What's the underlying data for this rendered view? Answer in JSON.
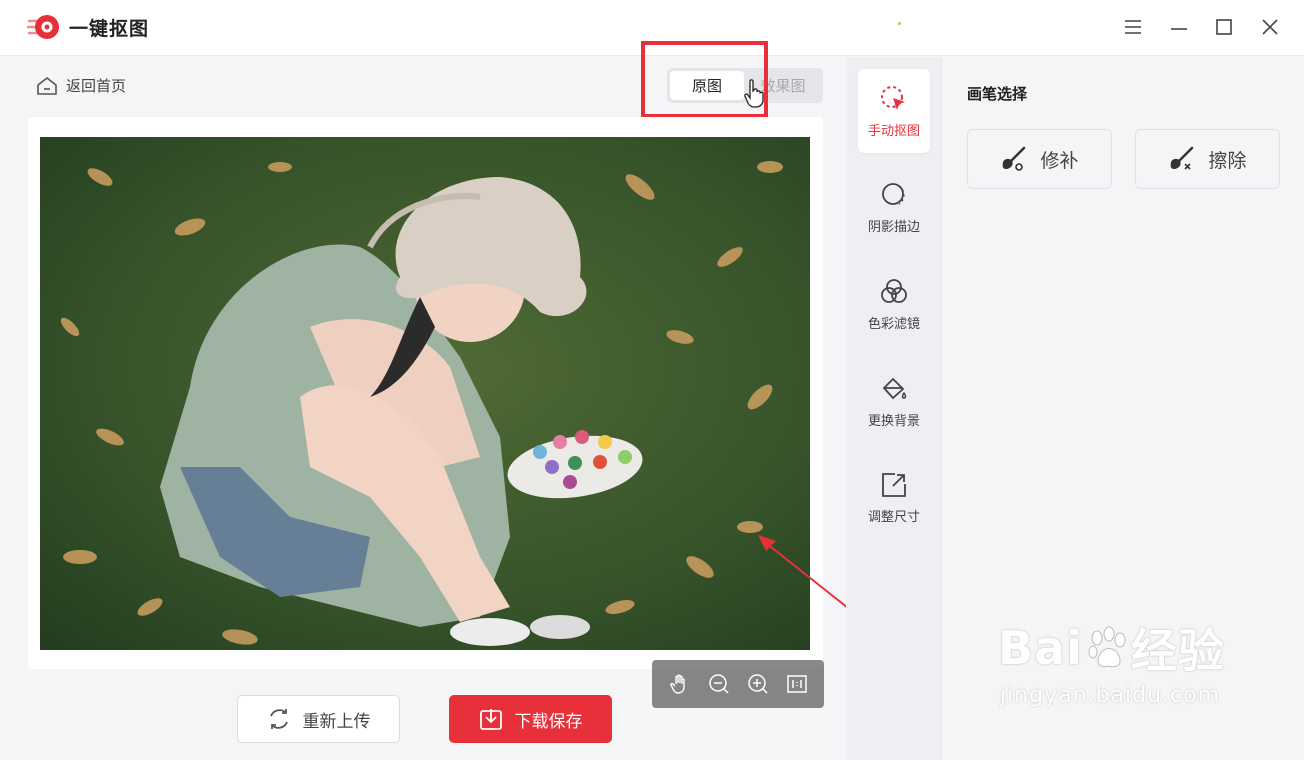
{
  "app": {
    "title": "一键抠图"
  },
  "window": {
    "menu_icon": "hamburger-icon",
    "min_icon": "minimize-icon",
    "max_icon": "maximize-icon",
    "close_icon": "close-icon"
  },
  "work": {
    "back_label": "返回首页",
    "toggle": {
      "original": "原图",
      "result": "效果图"
    },
    "zoom_tools": [
      "hand-icon",
      "zoom-out-icon",
      "zoom-in-icon",
      "actual-size-icon"
    ],
    "buttons": {
      "reupload": "重新上传",
      "download": "下载保存"
    }
  },
  "tools": [
    {
      "label": "手动抠图",
      "icon": "manual-cutout-icon",
      "active": true
    },
    {
      "label": "阴影描边",
      "icon": "shadow-outline-icon",
      "active": false
    },
    {
      "label": "色彩滤镜",
      "icon": "color-filter-icon",
      "active": false
    },
    {
      "label": "更换背景",
      "icon": "change-background-icon",
      "active": false
    },
    {
      "label": "调整尺寸",
      "icon": "resize-icon",
      "active": false
    }
  ],
  "panel": {
    "title": "画笔选择",
    "brushes": [
      {
        "label": "修补",
        "icon": "repair-brush-icon"
      },
      {
        "label": "擦除",
        "icon": "erase-brush-icon"
      }
    ]
  },
  "watermark": {
    "main_prefix": "Bai",
    "main_suffix": "经验",
    "sub": "jingyan.baidu.com"
  },
  "colors": {
    "accent": "#e8303a",
    "annotation": "#e8303a"
  }
}
